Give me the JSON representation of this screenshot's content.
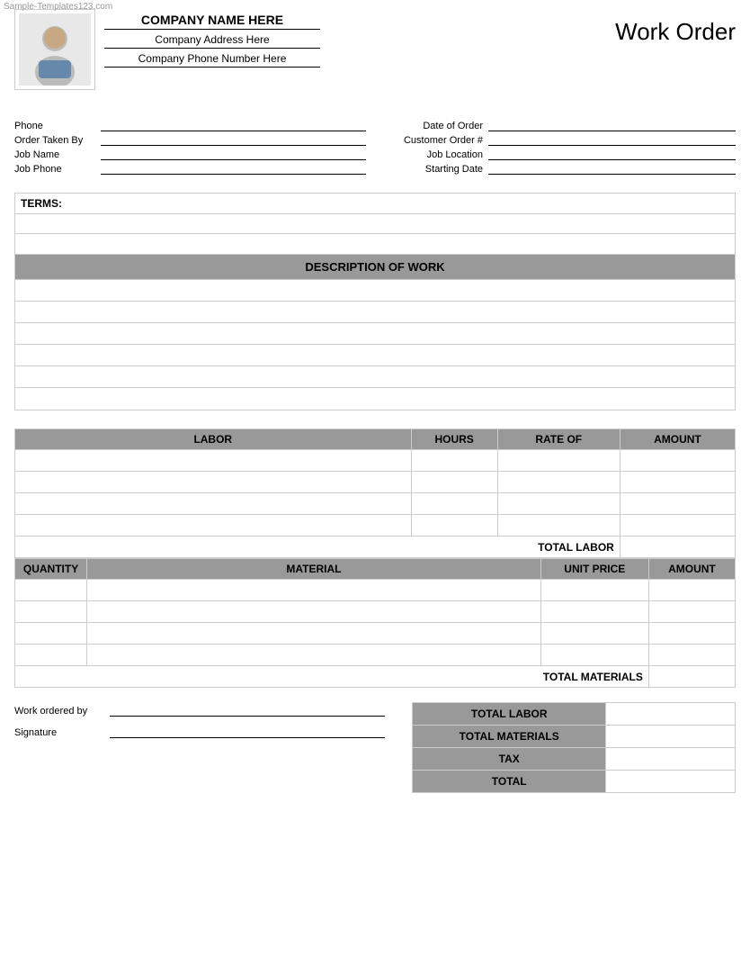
{
  "watermark": "Sample-Templates123.com",
  "header": {
    "company_name": "COMPANY NAME HERE",
    "company_address": "Company Address Here",
    "company_phone": "Company Phone Number Here",
    "title": "Work Order"
  },
  "form": {
    "fields_left": [
      {
        "label": "Phone",
        "value": ""
      },
      {
        "label": "Order Taken By",
        "value": ""
      },
      {
        "label": "Job Name",
        "value": ""
      },
      {
        "label": "Job Phone",
        "value": ""
      }
    ],
    "fields_right": [
      {
        "label": "Date of Order",
        "value": ""
      },
      {
        "label": "Customer Order #",
        "value": ""
      },
      {
        "label": "Job Location",
        "value": ""
      },
      {
        "label": "Starting Date",
        "value": ""
      }
    ]
  },
  "terms": {
    "label": "TERMS:",
    "rows": 3
  },
  "description": {
    "header": "DESCRIPTION OF WORK",
    "rows": 6
  },
  "labor": {
    "columns": [
      "LABOR",
      "HOURS",
      "RATE OF",
      "AMOUNT"
    ],
    "rows": 4,
    "total_label": "TOTAL LABOR"
  },
  "materials": {
    "columns": [
      "QUANTITY",
      "MATERIAL",
      "UNIT PRICE",
      "AMOUNT"
    ],
    "rows": 4,
    "total_label": "TOTAL MATERIALS"
  },
  "summary": {
    "work_ordered_label": "Work ordered by",
    "signature_label": "Signature",
    "totals": [
      {
        "label": "TOTAL LABOR"
      },
      {
        "label": "TOTAL MATERIALS"
      },
      {
        "label": "TAX"
      },
      {
        "label": "TOTAL"
      }
    ]
  }
}
